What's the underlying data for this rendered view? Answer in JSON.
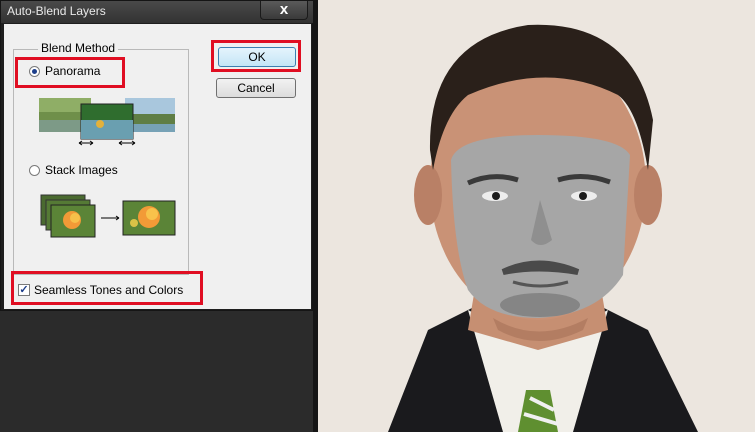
{
  "dialog": {
    "title": "Auto-Blend Layers",
    "close_label": "x",
    "blend_method_label": "Blend Method",
    "options": [
      {
        "label": "Panorama",
        "selected": true
      },
      {
        "label": "Stack Images",
        "selected": false
      }
    ],
    "seamless_label": "Seamless Tones and Colors",
    "seamless_checked": true,
    "ok_label": "OK",
    "cancel_label": "Cancel"
  },
  "colors": {
    "highlight": "#e00e22",
    "dialog_bg": "#f0f0f0",
    "titlebar": "#3a3a3a",
    "workspace": "#2b2b2b"
  }
}
